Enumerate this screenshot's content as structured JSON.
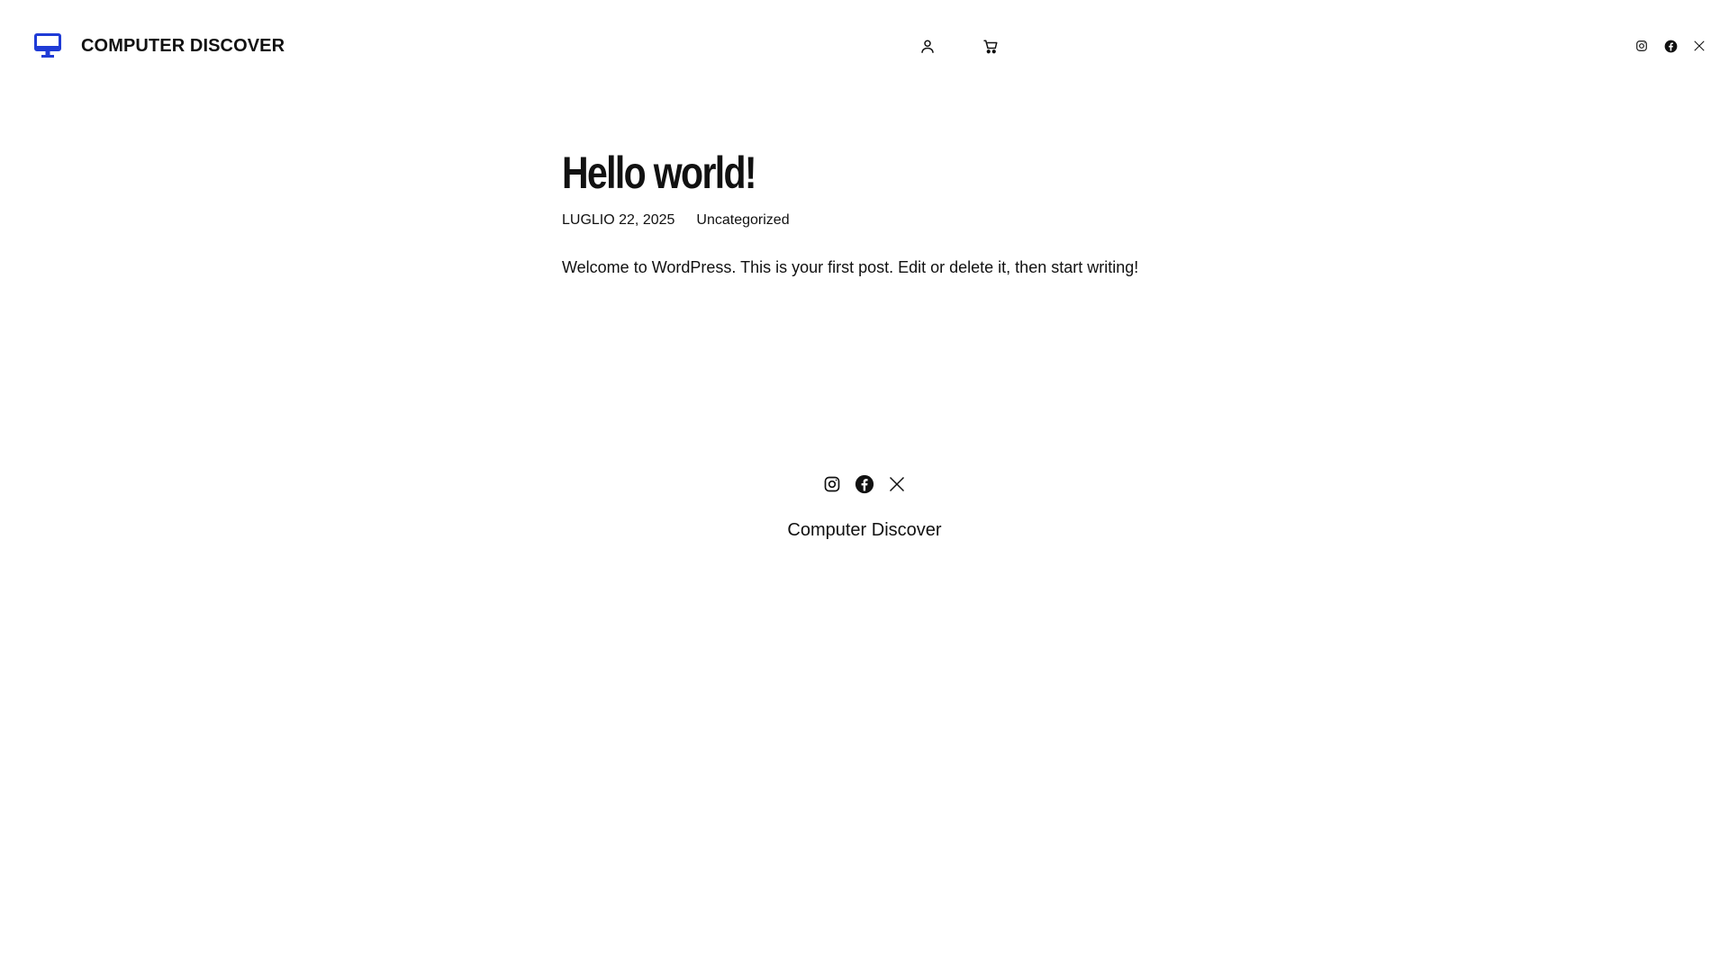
{
  "header": {
    "site_title": "COMPUTER DISCOVER",
    "logo_icon": "desktop-computer-icon",
    "account_icon": "user-icon",
    "cart_icon": "cart-icon",
    "social": [
      "instagram-icon",
      "facebook-icon",
      "x-icon"
    ]
  },
  "post": {
    "title": "Hello world!",
    "date": "LUGLIO 22, 2025",
    "category": "Uncategorized",
    "content": "Welcome to WordPress. This is your first post. Edit or delete it, then start writing!"
  },
  "footer": {
    "social": [
      "instagram-icon",
      "facebook-icon",
      "x-icon"
    ],
    "site_title": "Computer Discover"
  },
  "colors": {
    "brand": "#1f3bd6",
    "text": "#111111",
    "background": "#ffffff"
  }
}
